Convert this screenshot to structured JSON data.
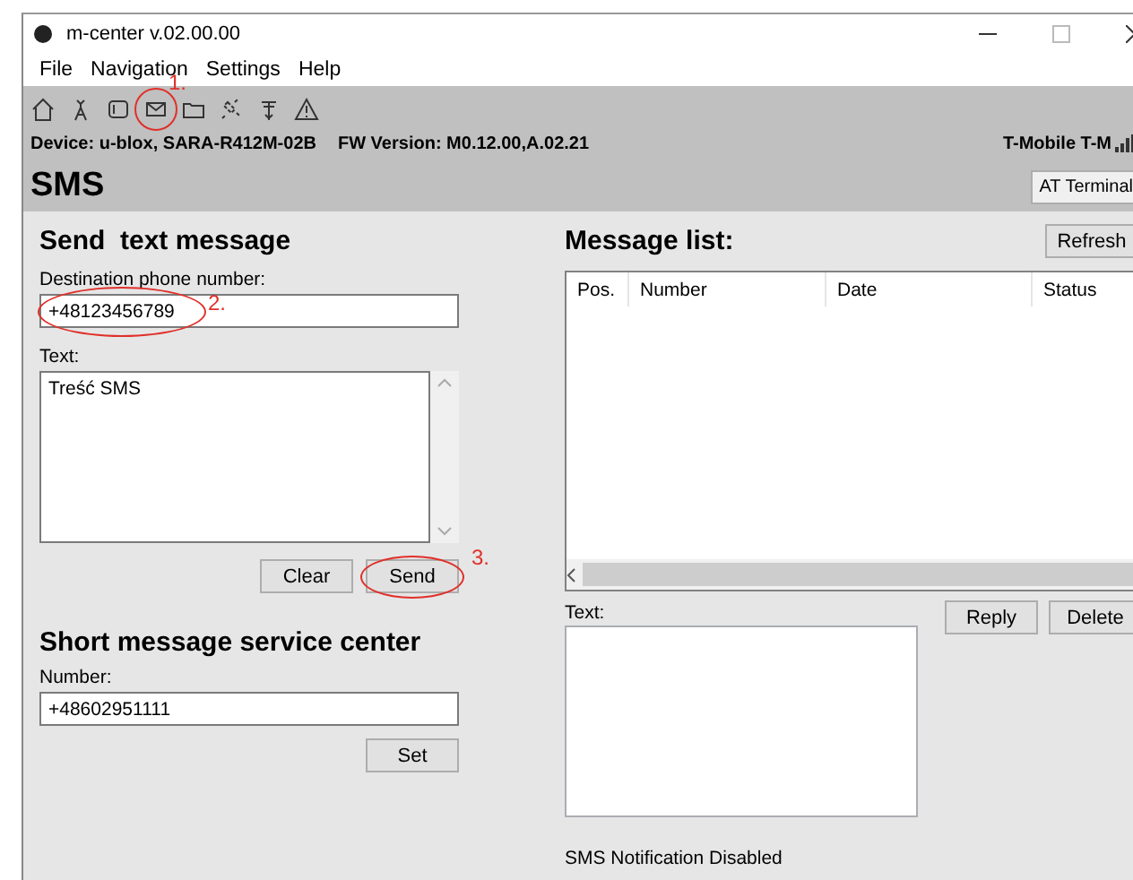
{
  "window": {
    "title": "m-center v.02.00.00"
  },
  "menu": [
    "File",
    "Navigation",
    "Settings",
    "Help"
  ],
  "device_info": {
    "device": "Device: u-blox, SARA-R412M-02B",
    "firmware": "FW Version: M0.12.00,A.02.21",
    "operator": "T-Mobile T-M"
  },
  "page_title": "SMS",
  "at_terminal_button": "AT Terminal",
  "send": {
    "title": "Send  text message",
    "destination_label": "Destination phone number:",
    "destination": "+48123456789",
    "text_label": "Text:",
    "text": "Treść SMS",
    "buttons": [
      "Clear",
      "Send"
    ]
  },
  "smsc": {
    "title": "Short message service center",
    "number_label": "Number:",
    "number": "+48602951111",
    "button": "Set"
  },
  "message_list": {
    "title": "Message list:",
    "refresh_button": "Refresh",
    "columns": [
      "Pos.",
      "Number",
      "Date",
      "Status"
    ],
    "text_label": "Text:",
    "buttons": [
      "Reply",
      "Delete"
    ]
  },
  "status": "SMS Notification Disabled",
  "annotations": [
    "1.",
    "2.",
    "3."
  ]
}
